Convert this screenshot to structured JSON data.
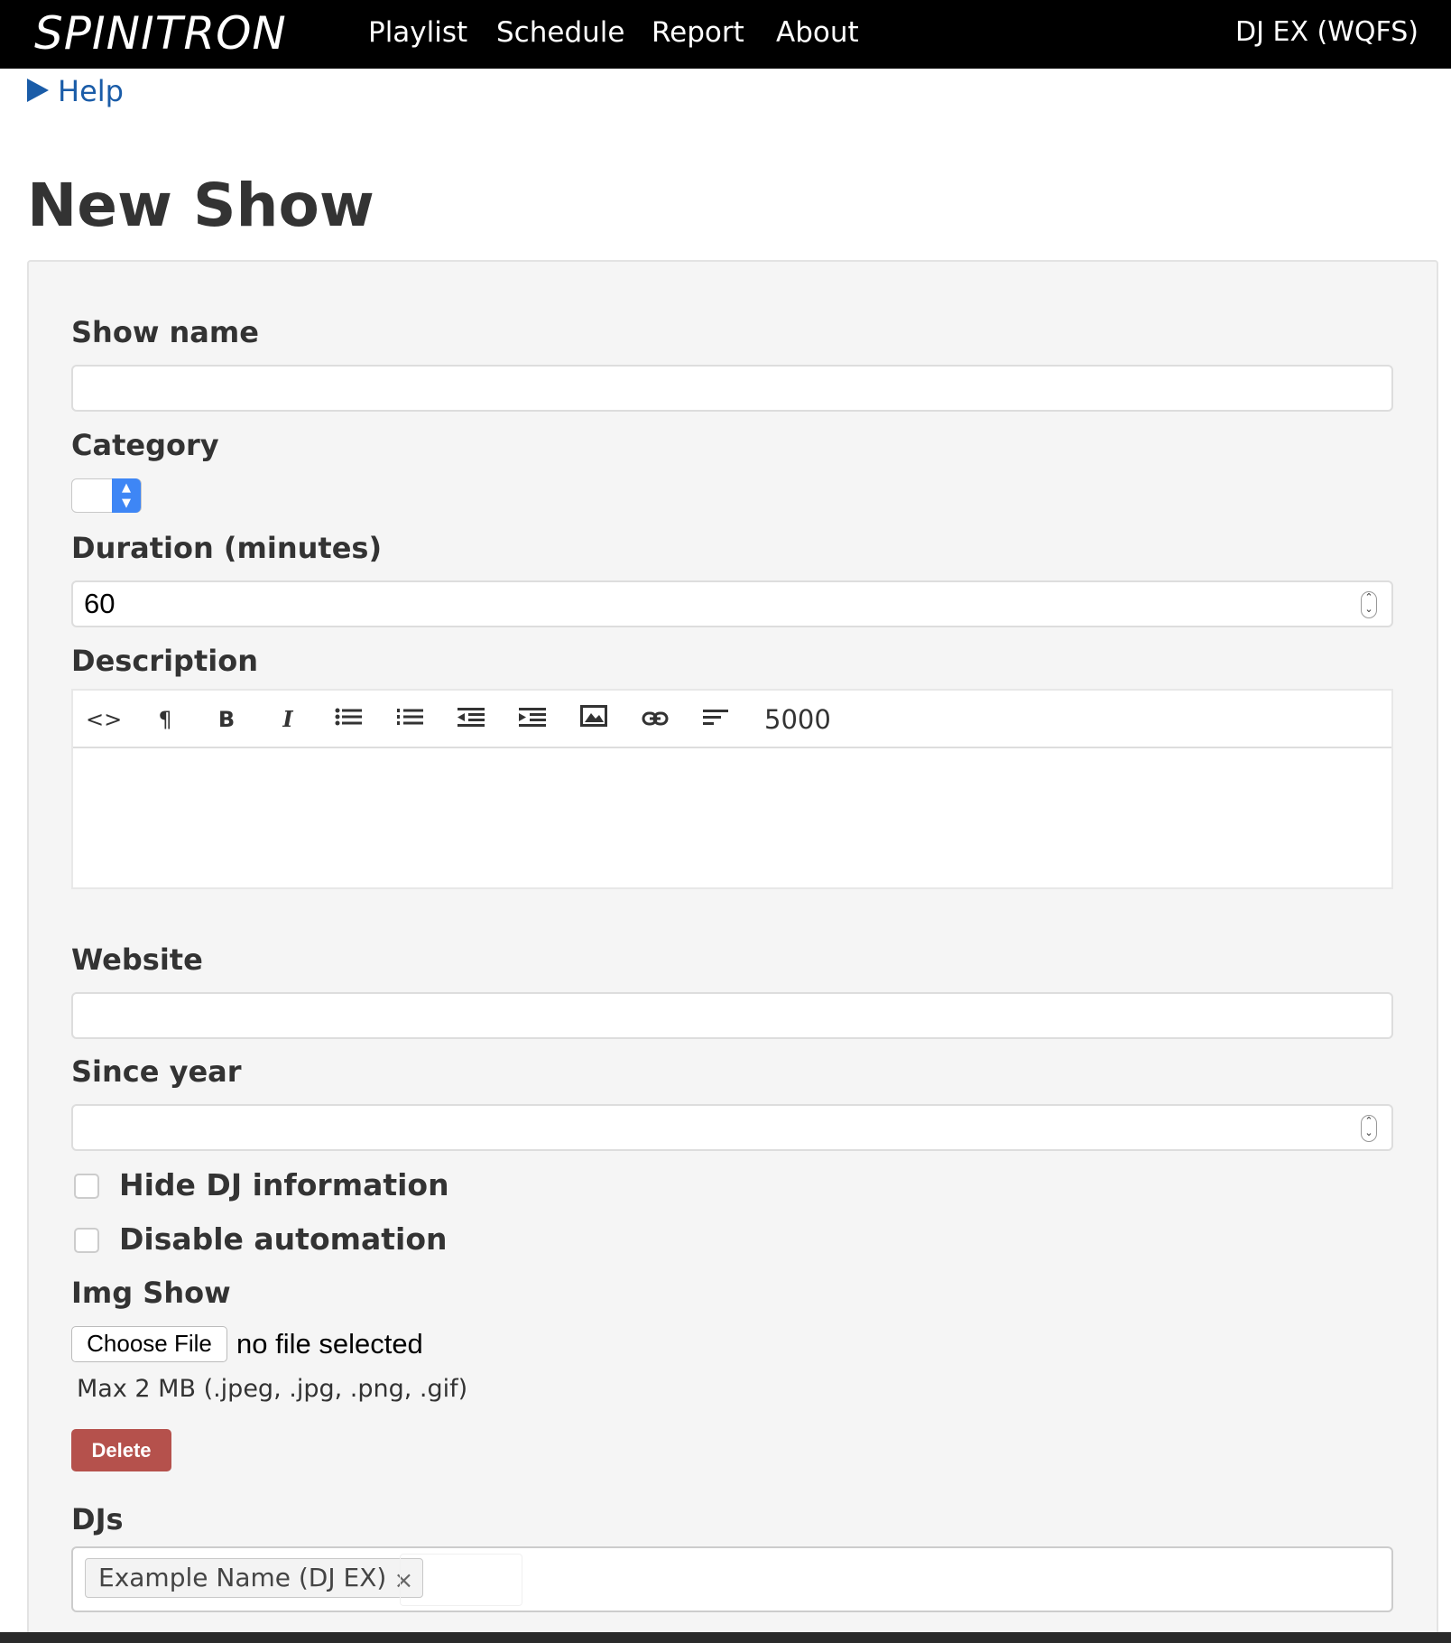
{
  "navbar": {
    "logo": "SPINITRON",
    "links": [
      "Playlist",
      "Schedule",
      "Report",
      "About"
    ],
    "user": "DJ EX (WQFS)"
  },
  "help": {
    "label": "Help"
  },
  "page": {
    "title": "New Show"
  },
  "form": {
    "show_name": {
      "label": "Show name",
      "value": ""
    },
    "category": {
      "label": "Category",
      "value": ""
    },
    "duration": {
      "label": "Duration (minutes)",
      "value": "60"
    },
    "description": {
      "label": "Description",
      "toolbar": [
        "code-view-icon",
        "paragraph-icon",
        "bold-icon",
        "italic-icon",
        "unordered-list-icon",
        "ordered-list-icon",
        "outdent-icon",
        "indent-icon",
        "image-icon",
        "link-icon",
        "align-left-icon"
      ],
      "char_counter": "5000",
      "value": ""
    },
    "website": {
      "label": "Website",
      "value": ""
    },
    "since_year": {
      "label": "Since year",
      "value": ""
    },
    "hide_dj_info": {
      "label": "Hide DJ information",
      "checked": false
    },
    "disable_automation": {
      "label": "Disable automation",
      "checked": false
    },
    "img_show": {
      "label": "Img Show",
      "button": "Choose File",
      "status": "no file selected",
      "help": "Max 2 MB (.jpeg, .jpg, .png, .gif)",
      "delete_label": "Delete"
    },
    "djs": {
      "label": "DJs",
      "tags": [
        "Example Name (DJ EX)"
      ]
    }
  },
  "colors": {
    "navbar": "#000000",
    "link": "#1a5ca8",
    "delete": "#b5514c",
    "select_accent": "#3e86f5",
    "panel": "#f5f5f5"
  }
}
